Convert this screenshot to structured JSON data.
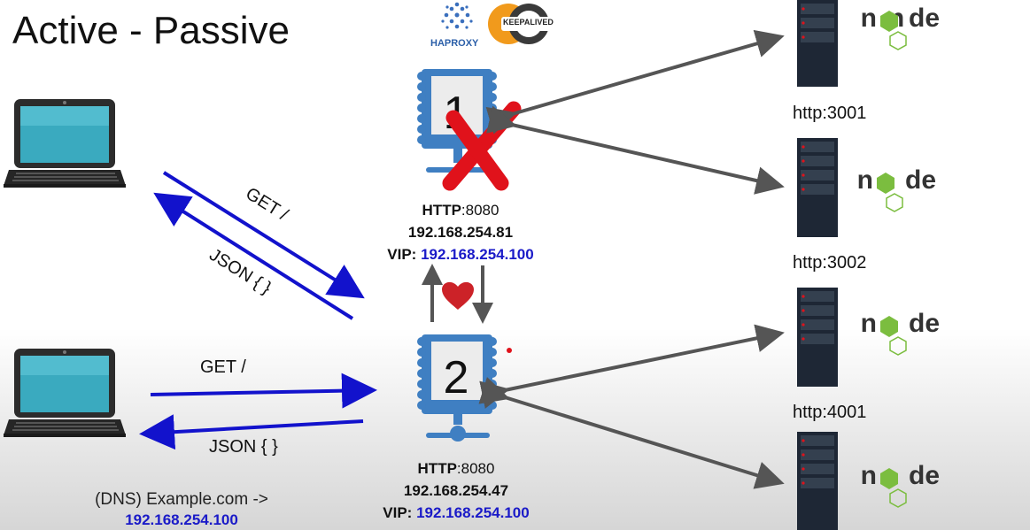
{
  "title": "Active - Passive",
  "logos": {
    "haproxy": "HAPROXY",
    "keepalived": "KEEPALIVED"
  },
  "proxy1": {
    "number": "1",
    "status": "failed",
    "http_label": "HTTP",
    "http_port": ":8080",
    "ip": "192.168.254.81",
    "vip_label": "VIP: ",
    "vip": "192.168.254.100"
  },
  "proxy2": {
    "number": "2",
    "status": "active",
    "http_label": "HTTP",
    "http_port": ":8080",
    "ip": "192.168.254.47",
    "vip_label": "VIP: ",
    "vip": "192.168.254.100"
  },
  "client_top": {
    "request": "GET /",
    "response": "JSON { }"
  },
  "client_bottom": {
    "request": "GET /",
    "response": "JSON { }"
  },
  "dns": {
    "label": "(DNS) Example.com ->",
    "ip": "192.168.254.100"
  },
  "backends": [
    {
      "port_label": "",
      "logo": "node"
    },
    {
      "port_label": "http:3001",
      "logo": "node"
    },
    {
      "port_label": "http:3002",
      "logo": "node"
    },
    {
      "port_label": "http:4001",
      "logo": "node"
    }
  ],
  "colors": {
    "client_arrow": "#1212cc",
    "server_arrow": "#555555",
    "failure_x": "#e0121b",
    "heart": "#cc2228",
    "node_green": "#7bbd3f",
    "vip_blue": "#1a1ac8"
  }
}
